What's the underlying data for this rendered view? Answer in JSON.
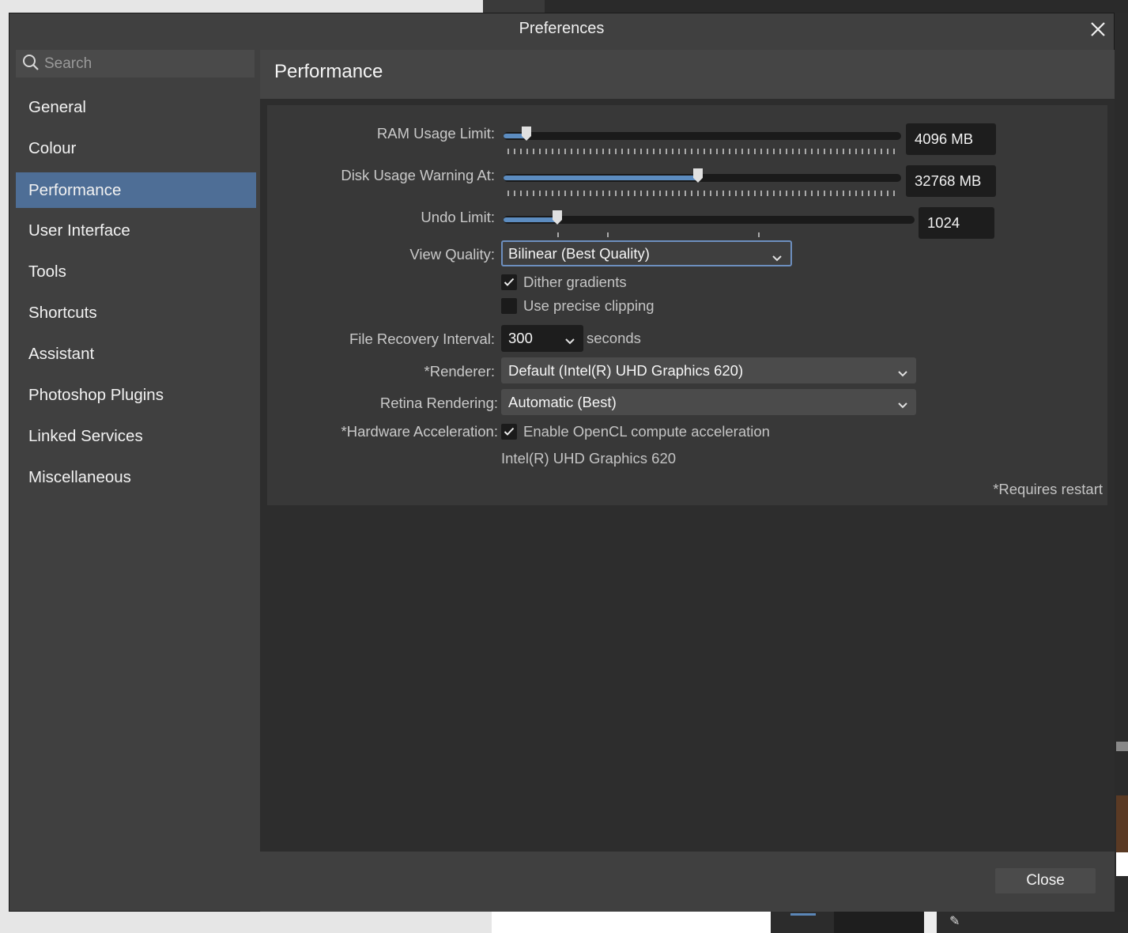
{
  "window": {
    "title": "Preferences"
  },
  "search": {
    "placeholder": "Search"
  },
  "sidebar": {
    "items": [
      {
        "label": "General"
      },
      {
        "label": "Colour"
      },
      {
        "label": "Performance",
        "active": true
      },
      {
        "label": "User Interface"
      },
      {
        "label": "Tools"
      },
      {
        "label": "Shortcuts"
      },
      {
        "label": "Assistant"
      },
      {
        "label": "Photoshop Plugins"
      },
      {
        "label": "Linked Services"
      },
      {
        "label": "Miscellaneous"
      }
    ]
  },
  "panel": {
    "title": "Performance",
    "ram": {
      "label": "RAM Usage Limit:",
      "value": "4096 MB",
      "fraction": 0.057
    },
    "disk": {
      "label": "Disk Usage Warning At:",
      "value": "32768 MB",
      "fraction": 0.49
    },
    "undo": {
      "label": "Undo Limit:",
      "value": "1024",
      "fraction": 0.13
    },
    "view_quality": {
      "label": "View Quality:",
      "value": "Bilinear (Best Quality)"
    },
    "dither": {
      "label": "Dither gradients",
      "checked": true
    },
    "precise_clipping": {
      "label": "Use precise clipping",
      "checked": false
    },
    "file_recovery": {
      "label": "File Recovery Interval:",
      "value": "300",
      "unit": "seconds"
    },
    "renderer": {
      "label": "*Renderer:",
      "value": "Default (Intel(R) UHD Graphics 620)"
    },
    "retina": {
      "label": "Retina Rendering:",
      "value": "Automatic (Best)"
    },
    "hw_accel": {
      "label": "*Hardware Acceleration:",
      "option": "Enable OpenCL compute acceleration",
      "checked": true,
      "device": "Intel(R) UHD Graphics 620"
    },
    "restart_note": "*Requires restart"
  },
  "footer": {
    "close_label": "Close"
  },
  "colors": {
    "accent": "#4e6e96",
    "slider_fill": "#5c8cc0",
    "focus_border": "#6d8fbf"
  },
  "icons": {
    "search": "search-icon",
    "close": "close-icon",
    "chevron": "chevron-down-icon",
    "check": "checkmark-icon"
  }
}
